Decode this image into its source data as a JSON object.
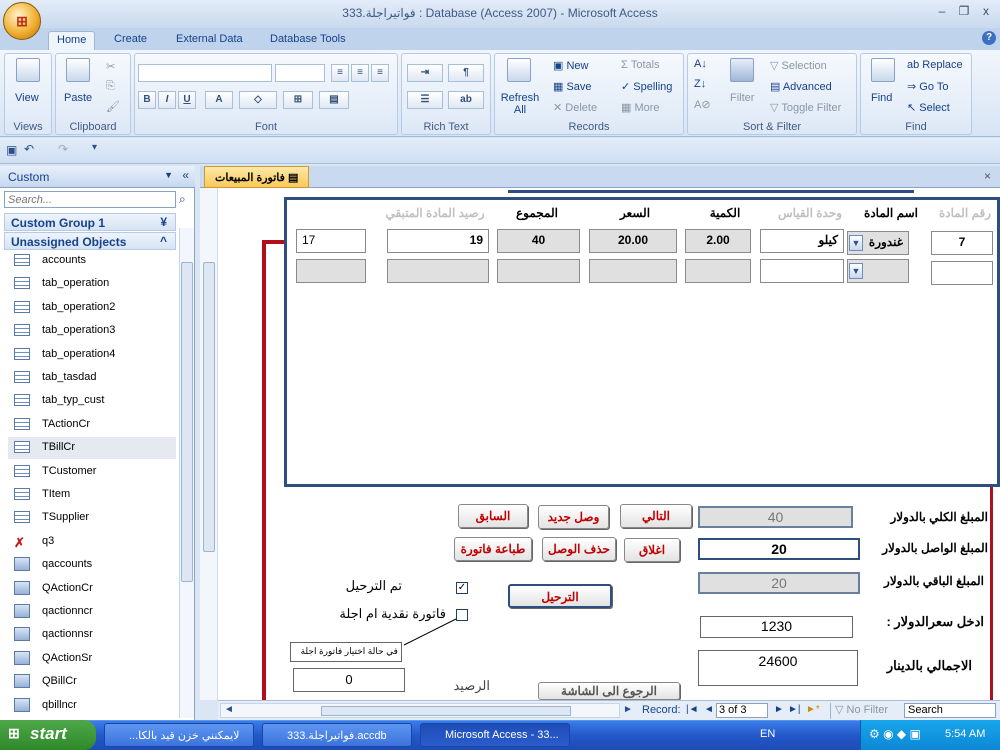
{
  "window": {
    "title": "فواتيراجلة.333 : Database (Access 2007) - Microsoft Access",
    "office_button": "Office",
    "minimize": "–",
    "restore": "❐",
    "close": "x"
  },
  "ribbon_tabs": [
    "Home",
    "Create",
    "External Data",
    "Database Tools"
  ],
  "ribbon": {
    "views": {
      "label": "View",
      "group": "Views"
    },
    "clipboard": {
      "paste": "Paste",
      "group": "Clipboard"
    },
    "font": {
      "group": "Font",
      "bold": "B",
      "italic": "I",
      "underline": "U",
      "font_color": "A"
    },
    "rich_text": {
      "group": "Rich Text"
    },
    "records": {
      "group": "Records",
      "refresh": "Refresh All",
      "new": "New",
      "save": "Save",
      "delete": "Delete",
      "totals": "Totals",
      "spelling": "Spelling",
      "more": "More"
    },
    "sort_filter": {
      "group": "Sort & Filter",
      "filter": "Filter",
      "selection": "Selection",
      "advanced": "Advanced",
      "toggle": "Toggle Filter"
    },
    "find": {
      "group": "Find",
      "find": "Find",
      "replace": "Replace",
      "goto": "Go To",
      "select": "Select"
    }
  },
  "nav": {
    "header": "Custom",
    "search_placeholder": "Search...",
    "group1": "Custom Group 1",
    "group2": "Unassigned Objects",
    "items": [
      {
        "label": "accounts",
        "type": "table"
      },
      {
        "label": "tab_operation",
        "type": "table"
      },
      {
        "label": "tab_operation2",
        "type": "table"
      },
      {
        "label": "tab_operation3",
        "type": "table"
      },
      {
        "label": "tab_operation4",
        "type": "table"
      },
      {
        "label": "tab_tasdad",
        "type": "table"
      },
      {
        "label": "tab_typ_cust",
        "type": "table"
      },
      {
        "label": "TActionCr",
        "type": "table"
      },
      {
        "label": "TBillCr",
        "type": "table"
      },
      {
        "label": "TCustomer",
        "type": "table"
      },
      {
        "label": "TItem",
        "type": "table"
      },
      {
        "label": "TSupplier",
        "type": "table"
      },
      {
        "label": "q3",
        "type": "error"
      },
      {
        "label": "qaccounts",
        "type": "query"
      },
      {
        "label": "QActionCr",
        "type": "query"
      },
      {
        "label": "qactionncr",
        "type": "query"
      },
      {
        "label": "qactionnsr",
        "type": "query"
      },
      {
        "label": "QActionSr",
        "type": "query"
      },
      {
        "label": "QBillCr",
        "type": "query"
      },
      {
        "label": "qbillncr",
        "type": "query"
      }
    ]
  },
  "form": {
    "tab_title": "فاتورة المبيعات",
    "columns": {
      "item_no": "رقم المادة",
      "item_name": "اسم المادة",
      "unit": "وحدة القياس",
      "qty": "الكمية",
      "price": "السعر",
      "total": "المجموع",
      "balance": "رصيد المادة المتبقي"
    },
    "row1": {
      "item_no": "7",
      "item_name": "غندورة",
      "unit": "كيلو",
      "qty": "2.00",
      "price": "20.00",
      "total": "40",
      "balance": "19",
      "extra": "17"
    },
    "labels": {
      "total_usd": "المبلغ الكلي بالدولار",
      "paid_usd": "المبلغ الواصل بالدولار",
      "remaining_usd": "المبلغ الباقي بالدولار",
      "rate": "ادخل سعرالدولار :",
      "total_dinar": "الاجمالي بالدينار",
      "posted": "تم الترحيل",
      "cash_or_credit": "فاتورة نقدية ام اجلة",
      "balance": "الرصيد",
      "note": "في حالة اختيار فاتورة اجلة"
    },
    "values": {
      "total_usd": "40",
      "paid_usd": "20",
      "remaining_usd": "20",
      "rate": "1230",
      "total_dinar": "24600",
      "balance_box": "0"
    },
    "buttons": {
      "prev": "السابق",
      "new_receipt": "وصل جديد",
      "next": "التالي",
      "print": "طباعة فاتورة",
      "delete_receipt": "حذف الوصل",
      "close": "اغلاق",
      "post": "الترحيل",
      "back_main": "الرجوع الى الشاشة"
    }
  },
  "record_nav": {
    "label": "Record:",
    "current": "3 of 3",
    "filter": "No Filter",
    "search": "Search"
  },
  "taskbar": {
    "start": "start",
    "tasks": [
      "...لايمكنني خزن قيد بالكا",
      "فواتيراجلة.333",
      "فواتيراجلة.333.accdb",
      "Microsoft Access - 33..."
    ],
    "lang": "EN",
    "time": "5:54 AM"
  }
}
